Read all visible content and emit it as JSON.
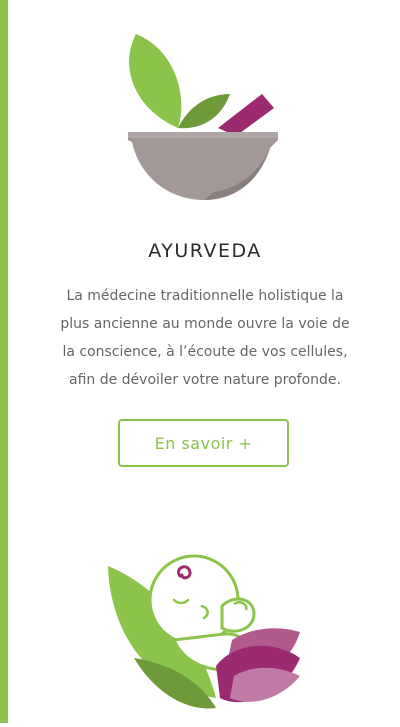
{
  "colors": {
    "accent_green": "#8cc34b",
    "plum": "#9b2a6f",
    "stone_gray": "#a39898",
    "text_dark": "#2b2b2b",
    "text_muted": "#666666"
  },
  "icons": {
    "mortar": "mortar-and-pestle-icon",
    "baby": "baby-icon"
  },
  "section": {
    "title": "AYURVEDA",
    "description": "La médecine traditionnelle holistique la plus ancienne au monde ouvre la voie de la conscience, à l’écoute de vos cellules, afin de dévoiler votre nature profonde.",
    "button_label": "En savoir +"
  }
}
